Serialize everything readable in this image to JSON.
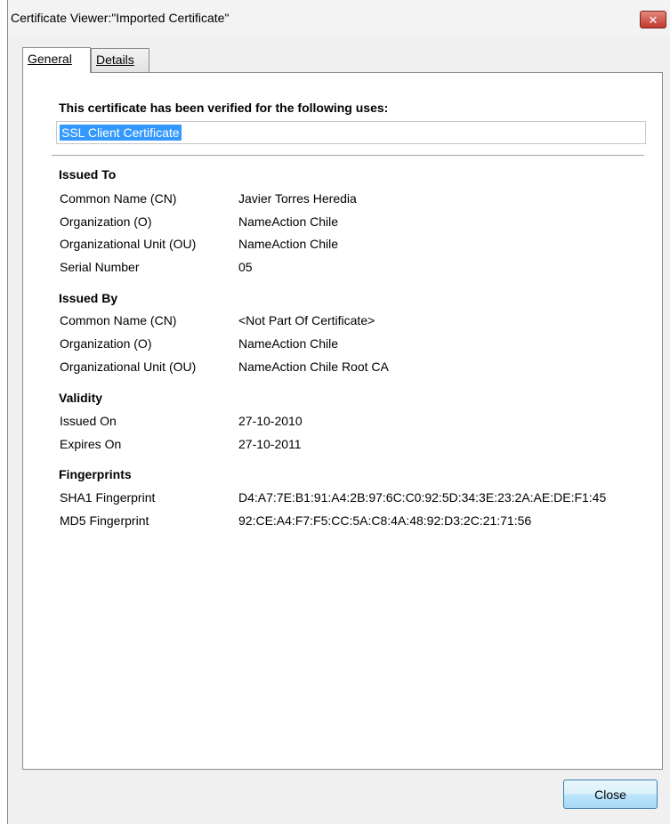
{
  "window": {
    "title": "Certificate Viewer:\"Imported Certificate\"",
    "close_glyph": "✕"
  },
  "tabs": [
    {
      "label": "General",
      "active": true
    },
    {
      "label": "Details",
      "active": false
    }
  ],
  "uses": {
    "heading": "This certificate has been verified for the following uses:",
    "value": "SSL Client Certificate"
  },
  "issued_to": {
    "heading": "Issued To",
    "rows": [
      {
        "label": "Common Name (CN)",
        "value": "Javier Torres Heredia"
      },
      {
        "label": "Organization (O)",
        "value": "NameAction Chile"
      },
      {
        "label": "Organizational Unit (OU)",
        "value": "NameAction Chile"
      },
      {
        "label": "Serial Number",
        "value": "05"
      }
    ]
  },
  "issued_by": {
    "heading": "Issued By",
    "rows": [
      {
        "label": "Common Name (CN)",
        "value": "<Not Part Of Certificate>"
      },
      {
        "label": "Organization (O)",
        "value": "NameAction Chile"
      },
      {
        "label": "Organizational Unit (OU)",
        "value": "NameAction Chile Root CA"
      }
    ]
  },
  "validity": {
    "heading": "Validity",
    "rows": [
      {
        "label": "Issued On",
        "value": "27-10-2010"
      },
      {
        "label": "Expires On",
        "value": "27-10-2011"
      }
    ]
  },
  "fingerprints": {
    "heading": "Fingerprints",
    "rows": [
      {
        "label": "SHA1 Fingerprint",
        "value": "D4:A7:7E:B1:91:A4:2B:97:6C:C0:92:5D:34:3E:23:2A:AE:DE:F1:45"
      },
      {
        "label": "MD5 Fingerprint",
        "value": "92:CE:A4:F7:F5:CC:5A:C8:4A:48:92:D3:2C:21:71:56"
      }
    ]
  },
  "footer": {
    "close_label": "Close"
  },
  "colors": {
    "selection": "#3399ff",
    "close_x": "#c0392b"
  }
}
